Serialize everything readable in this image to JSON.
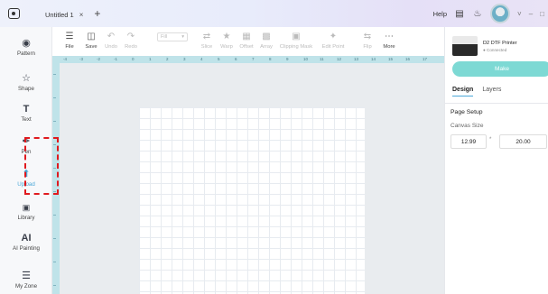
{
  "titlebar": {
    "tab_title": "Untitled 1",
    "tab_close": "×",
    "new_tab": "+",
    "help": "Help",
    "minimize": "–",
    "maximize": "□"
  },
  "sidebar": {
    "items": [
      {
        "label": "Pattern",
        "icon": "pattern-icon"
      },
      {
        "label": "Shape",
        "icon": "shape-icon"
      },
      {
        "label": "Text",
        "icon": "text-icon"
      },
      {
        "label": "Pen",
        "icon": "pen-icon"
      },
      {
        "label": "Upload",
        "icon": "upload-icon"
      },
      {
        "label": "Library",
        "icon": "library-icon"
      },
      {
        "label": "AI Painting",
        "icon": "ai-painting-icon"
      },
      {
        "label": "My Zone",
        "icon": "my-zone-icon"
      }
    ]
  },
  "toolbar": {
    "file": "File",
    "save": "Save",
    "undo": "Undo",
    "redo": "Redo",
    "size_value": "Fill",
    "slice": "Slice",
    "warp": "Warp",
    "offset": "Offset",
    "array": "Array",
    "clipping_mask": "Clipping Mask",
    "edit_point": "Edit Point",
    "flip": "Flip",
    "more": "More"
  },
  "ruler": {
    "top": [
      "-4",
      "-3",
      "-2",
      "-1",
      "0",
      "1",
      "2",
      "3",
      "4",
      "5",
      "6",
      "7",
      "8",
      "9",
      "10",
      "11",
      "12",
      "13",
      "14",
      "15",
      "16",
      "17"
    ]
  },
  "right_panel": {
    "printer_name": "D2 DTF Printer",
    "printer_status": "● Connected",
    "make": "Make",
    "tab_design": "Design",
    "tab_layers": "Layers",
    "page_setup": "Page Setup",
    "canvas_size_label": "Canvas Size",
    "width": "12.99",
    "times": "*",
    "height": "20.00"
  },
  "colors": {
    "accent": "#4ba8d8",
    "make_button": "#7dd9d4",
    "ruler": "#bfe3e9",
    "highlight": "#e0191e"
  }
}
